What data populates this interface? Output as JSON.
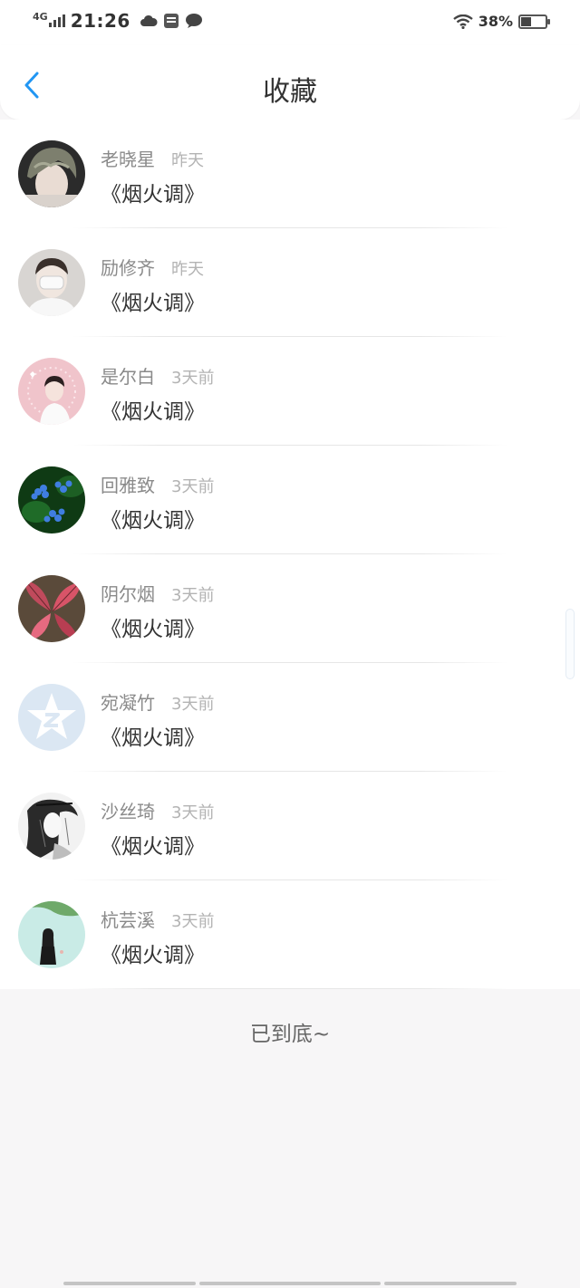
{
  "status_bar": {
    "network": "4G",
    "time": "21:26",
    "battery_percent": "38%",
    "battery_level": 0.38
  },
  "header": {
    "title": "收藏"
  },
  "favorites": [
    {
      "name": "老晓星",
      "time": "昨天",
      "work": "《烟火调》",
      "avatar": "avatar-dark-hair"
    },
    {
      "name": "励修齐",
      "time": "昨天",
      "work": "《烟火调》",
      "avatar": "avatar-mask-person"
    },
    {
      "name": "是尔白",
      "time": "3天前",
      "work": "《烟火调》",
      "avatar": "avatar-pink-boy"
    },
    {
      "name": "回雅致",
      "time": "3天前",
      "work": "《烟火调》",
      "avatar": "avatar-blue-flowers"
    },
    {
      "name": "阴尔烟",
      "time": "3天前",
      "work": "《烟火调》",
      "avatar": "avatar-red-leaves"
    },
    {
      "name": "宛凝竹",
      "time": "3天前",
      "work": "《烟火调》",
      "avatar": "avatar-default-star"
    },
    {
      "name": "沙丝琦",
      "time": "3天前",
      "work": "《烟火调》",
      "avatar": "avatar-ink-drawing"
    },
    {
      "name": "杭芸溪",
      "time": "3天前",
      "work": "《烟火调》",
      "avatar": "avatar-girl-teal"
    }
  ],
  "footer": {
    "end_text": "已到底~"
  },
  "colors": {
    "accent": "#2196F3",
    "background": "#f7f6f7"
  }
}
